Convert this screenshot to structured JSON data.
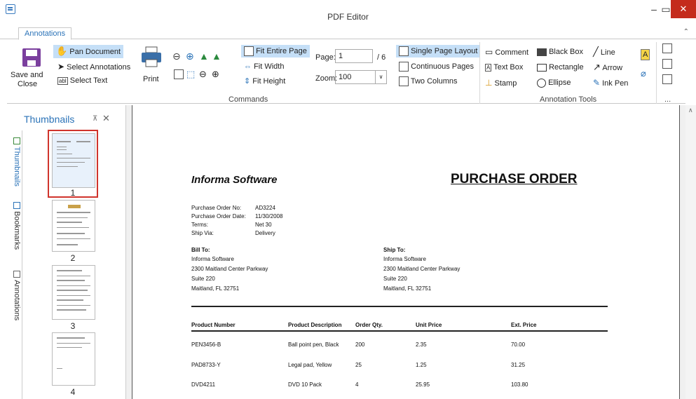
{
  "window": {
    "title": "PDF Editor",
    "minimize": "–",
    "maximize": "▭",
    "close": "✕"
  },
  "tabs": {
    "annotations": "Annotations",
    "collapse": "⌃"
  },
  "ribbon": {
    "save_close_line1": "Save and",
    "save_close_line2": "Close",
    "pan_document": "Pan Document",
    "select_annotations": "Select Annotations",
    "select_text": "Select Text",
    "print": "Print",
    "fit_entire_page": "Fit Entire Page",
    "fit_width": "Fit Width",
    "fit_height": "Fit Height",
    "page_label": "Page:",
    "page_value": "1",
    "page_total": "/ 6",
    "zoom_label": "Zoom:",
    "zoom_value": "100",
    "single_page_layout": "Single Page Layout",
    "continuous_pages": "Continuous Pages",
    "two_columns": "Two Columns",
    "comment": "Comment",
    "text_box": "Text Box",
    "stamp": "Stamp",
    "black_box": "Black Box",
    "rectangle": "Rectangle",
    "ellipse": "Ellipse",
    "line": "Line",
    "arrow": "Arrow",
    "ink_pen": "Ink Pen",
    "commands_group": "Commands",
    "annotation_tools_group": "Annotation Tools",
    "more_group": "..."
  },
  "sidebar": {
    "title": "Thumbnails",
    "pin": "⊼",
    "close": "✕",
    "vtabs": [
      "Thumbnails",
      "Bookmarks",
      "Annotations"
    ],
    "thumb_numbers": [
      "1",
      "2",
      "3",
      "4"
    ]
  },
  "document": {
    "company": "Informa Software",
    "heading": "PURCHASE ORDER",
    "meta_labels": [
      "Purchase Order No:",
      "Purchase Order Date:",
      "Terms:",
      "Ship Via:"
    ],
    "meta_values": [
      "AD3224",
      "11/30/2008",
      "Net 30",
      "Delivery"
    ],
    "bill_to": {
      "label": "Bill To:",
      "lines": [
        "Informa Software",
        "2300 Maitland Center Parkway",
        "Suite 220",
        "Maitland, FL  32751"
      ]
    },
    "ship_to": {
      "label": "Ship To:",
      "lines": [
        "Informa Software",
        "2300 Maitland Center Parkway",
        "Suite 220",
        "Maitland, FL  32751"
      ]
    },
    "columns": [
      "Product Number",
      "Product Description",
      "Order Qty.",
      "Unit Price",
      "Ext. Price"
    ],
    "rows": [
      [
        "PEN3456-B",
        "Ball point pen, Black",
        "200",
        "2.35",
        "70.00"
      ],
      [
        "PAD8733-Y",
        "Legal pad, Yellow",
        "25",
        "1.25",
        "31.25"
      ],
      [
        "DVD4211",
        "DVD 10 Pack",
        "4",
        "25.95",
        "103.80"
      ]
    ]
  },
  "colors": {
    "accent": "#2b73b8",
    "selection": "#c5dff7",
    "close": "#c42b1c",
    "thumb_highlight": "#d0342c"
  }
}
